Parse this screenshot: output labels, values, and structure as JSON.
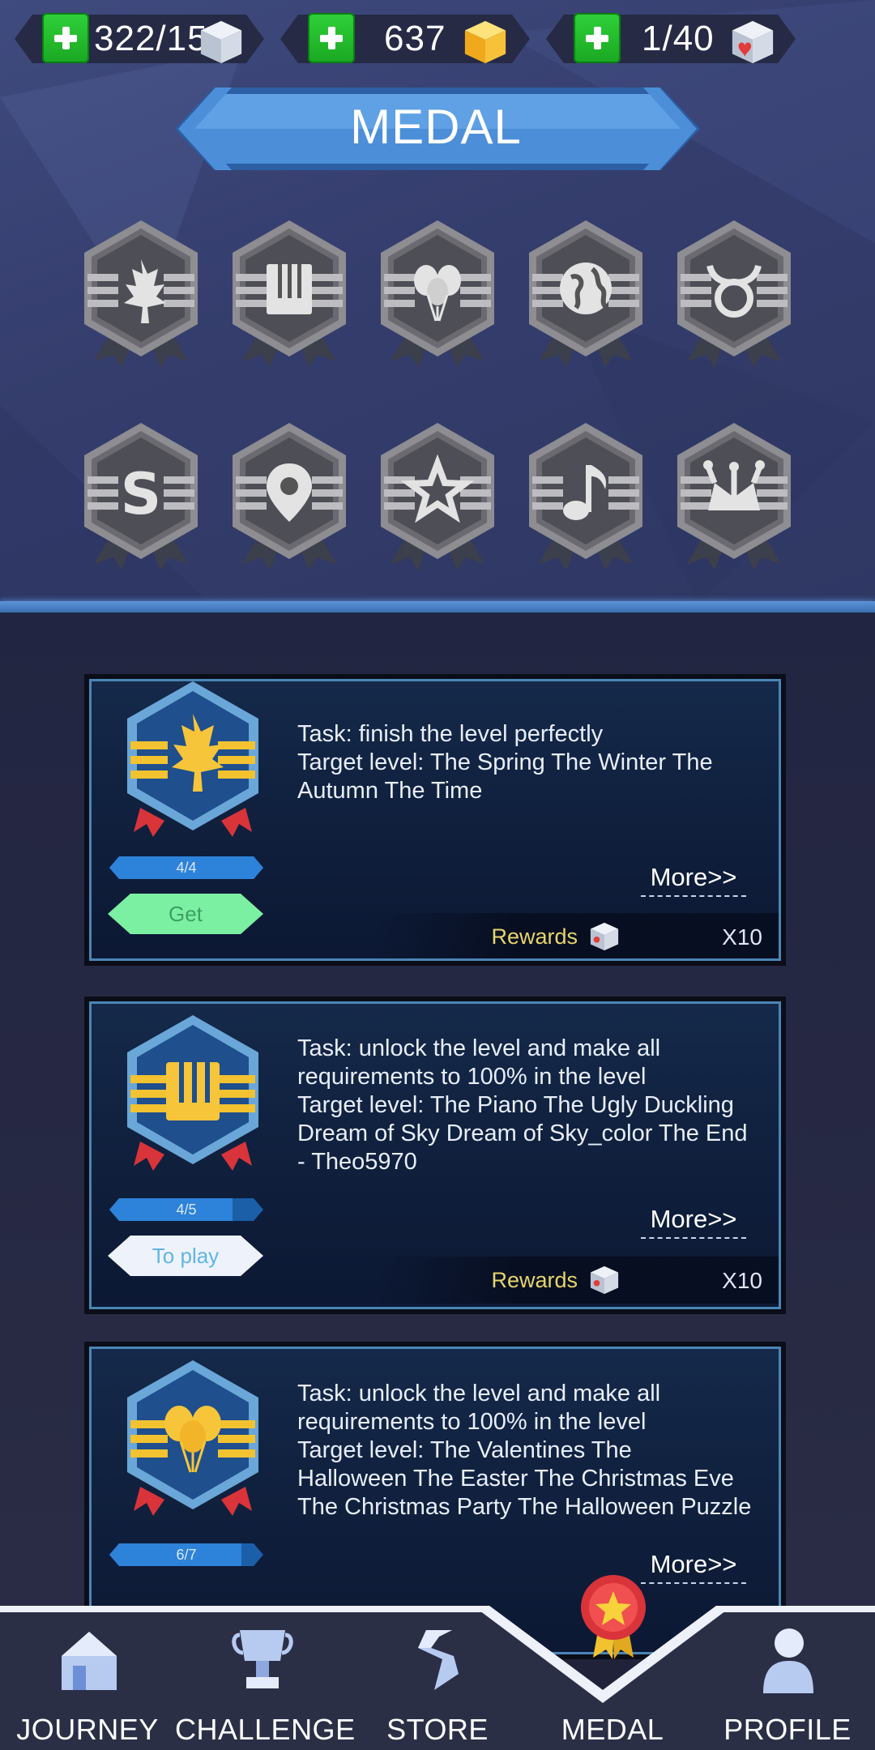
{
  "currency": {
    "cubes": "322/15",
    "gold": "637",
    "lives": "1/40"
  },
  "banner": {
    "title": "MEDAL"
  },
  "medals": [
    {
      "icon": "maple-leaf-icon"
    },
    {
      "icon": "piano-icon"
    },
    {
      "icon": "balloons-icon"
    },
    {
      "icon": "globe-icon"
    },
    {
      "icon": "taurus-icon"
    },
    {
      "icon": "letter-s-icon"
    },
    {
      "icon": "location-pin-icon"
    },
    {
      "icon": "star-icon"
    },
    {
      "icon": "music-note-icon"
    },
    {
      "icon": "jester-hat-icon"
    }
  ],
  "cards": [
    {
      "task": "Task: finish the level perfectly\nTarget level: The Spring The Winter The\nAutumn The Time",
      "progress_text": "4/4",
      "progress": 1.0,
      "button": "Get",
      "more": "More>>",
      "rewards_label": "Rewards",
      "rewards_qty": "X10"
    },
    {
      "task": "Task: unlock the level and make all\nrequirements to 100% in the level\nTarget level: The Piano The Ugly Duckling\nDream of Sky Dream of Sky_color The End\n- Theo5970",
      "progress_text": "4/5",
      "progress": 0.8,
      "button": "To play",
      "more": "More>>",
      "rewards_label": "Rewards",
      "rewards_qty": "X10"
    },
    {
      "task": "Task: unlock the level and make all\nrequirements to 100% in the level\nTarget level: The Valentines The\nHalloween The Easter The Christmas Eve\nThe Christmas Party The Halloween Puzzle",
      "progress_text": "6/7",
      "progress": 0.857,
      "more": "More>>"
    }
  ],
  "nav": {
    "journey": "JOURNEY",
    "challenge": "CHALLENGE",
    "store": "STORE",
    "medal": "MEDAL",
    "profile": "PROFILE"
  },
  "colors": {
    "accent_blue": "#4a85b6",
    "gold": "#f2c230",
    "get_button": "#7cf0a2",
    "plus_green": "#1fbf2a"
  }
}
